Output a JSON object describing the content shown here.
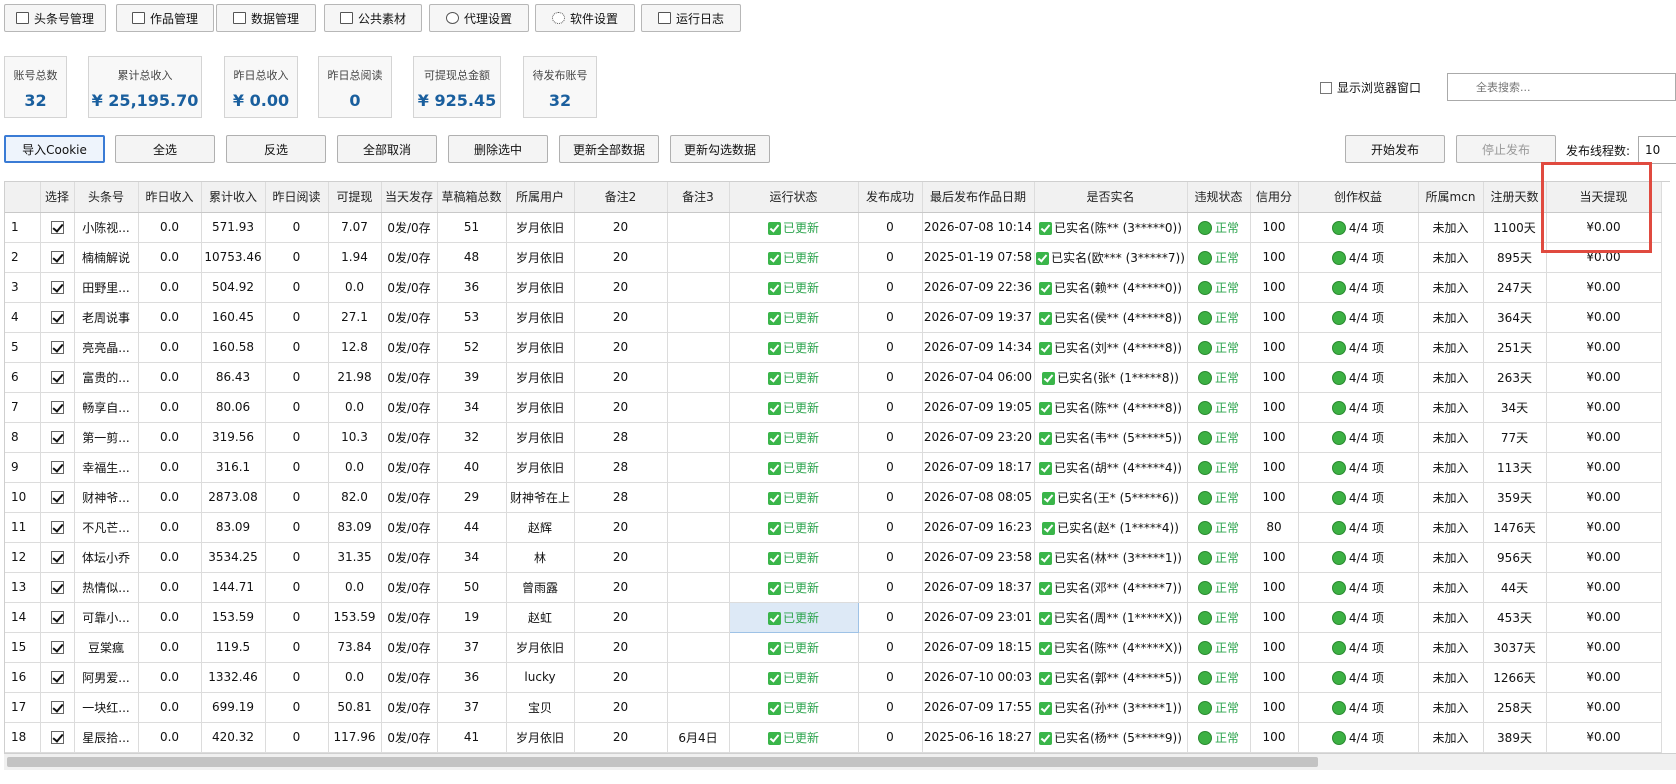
{
  "tabs": [
    {
      "label": "头条号管理",
      "icon": "list-icon"
    },
    {
      "label": "作品管理",
      "icon": "document-icon"
    },
    {
      "label": "数据管理",
      "icon": "database-icon"
    },
    {
      "label": "公共素材",
      "icon": "image-icon"
    },
    {
      "label": "代理设置",
      "icon": "globe-icon"
    },
    {
      "label": "软件设置",
      "icon": "gear-icon"
    },
    {
      "label": "运行日志",
      "icon": "log-icon"
    }
  ],
  "stats": [
    {
      "label": "账号总数",
      "value": "32"
    },
    {
      "label": "累计总收入",
      "value": "¥ 25,195.70"
    },
    {
      "label": "昨日总收入",
      "value": "¥ 0.00"
    },
    {
      "label": "昨日总阅读",
      "value": "0"
    },
    {
      "label": "可提现总金额",
      "value": "¥ 925.45"
    },
    {
      "label": "待发布账号",
      "value": "32"
    }
  ],
  "show_browser_label": "显示浏览器窗口",
  "search_placeholder": "全表搜索...",
  "actions": {
    "import_cookie": "导入Cookie",
    "select_all": "全选",
    "invert": "反选",
    "cancel_all": "全部取消",
    "delete_selected": "删除选中",
    "update_all": "更新全部数据",
    "update_checked": "更新勾选数据",
    "start_publish": "开始发布",
    "stop_publish": "停止发布",
    "thread_label": "发布线程数:",
    "thread_value": "10"
  },
  "columns": [
    "",
    "选择",
    "头条号",
    "昨日收入",
    "累计收入",
    "昨日阅读",
    "可提现",
    "当天发存",
    "草稿箱总数",
    "所属用户",
    "备注2",
    "备注3",
    "运行状态",
    "发布成功",
    "最后发布作品日期",
    "是否实名",
    "违规状态",
    "信用分",
    "创作权益",
    "所属mcn",
    "注册天数",
    "当天提现"
  ],
  "rows": [
    {
      "idx": "1",
      "name": "小陈视...",
      "yinc": "0.0",
      "total": "571.93",
      "yread": "0",
      "withdraw": "7.07",
      "today": "0发/0存",
      "drafts": "51",
      "user": "岁月依旧",
      "note2": "20",
      "note3": "",
      "status": "已更新",
      "ok": "0",
      "date": "2026-07-08 10:14",
      "real": "已实名(陈** (3*****0))",
      "viol": "正常",
      "credit": "100",
      "rights": "4/4 项",
      "mcn": "未加入",
      "days": "1100天",
      "tw": "¥0.00"
    },
    {
      "idx": "2",
      "name": "楠楠解说",
      "yinc": "0.0",
      "total": "10753.46",
      "yread": "0",
      "withdraw": "1.94",
      "today": "0发/0存",
      "drafts": "48",
      "user": "岁月依旧",
      "note2": "20",
      "note3": "",
      "status": "已更新",
      "ok": "0",
      "date": "2025-01-19 07:58",
      "real": "已实名(欧*** (3*****7))",
      "viol": "正常",
      "credit": "100",
      "rights": "4/4 项",
      "mcn": "未加入",
      "days": "895天",
      "tw": "¥0.00"
    },
    {
      "idx": "3",
      "name": "田野里...",
      "yinc": "0.0",
      "total": "504.92",
      "yread": "0",
      "withdraw": "0.0",
      "today": "0发/0存",
      "drafts": "36",
      "user": "岁月依旧",
      "note2": "20",
      "note3": "",
      "status": "已更新",
      "ok": "0",
      "date": "2026-07-09 22:36",
      "real": "已实名(赖** (4*****0))",
      "viol": "正常",
      "credit": "100",
      "rights": "4/4 项",
      "mcn": "未加入",
      "days": "247天",
      "tw": "¥0.00"
    },
    {
      "idx": "4",
      "name": "老周说事",
      "yinc": "0.0",
      "total": "160.45",
      "yread": "0",
      "withdraw": "27.1",
      "today": "0发/0存",
      "drafts": "53",
      "user": "岁月依旧",
      "note2": "20",
      "note3": "",
      "status": "已更新",
      "ok": "0",
      "date": "2026-07-09 19:37",
      "real": "已实名(侯** (4*****8))",
      "viol": "正常",
      "credit": "100",
      "rights": "4/4 项",
      "mcn": "未加入",
      "days": "364天",
      "tw": "¥0.00"
    },
    {
      "idx": "5",
      "name": "亮亮晶...",
      "yinc": "0.0",
      "total": "160.58",
      "yread": "0",
      "withdraw": "12.8",
      "today": "0发/0存",
      "drafts": "52",
      "user": "岁月依旧",
      "note2": "20",
      "note3": "",
      "status": "已更新",
      "ok": "0",
      "date": "2026-07-09 14:34",
      "real": "已实名(刘** (4*****8))",
      "viol": "正常",
      "credit": "100",
      "rights": "4/4 项",
      "mcn": "未加入",
      "days": "251天",
      "tw": "¥0.00"
    },
    {
      "idx": "6",
      "name": "富贵的...",
      "yinc": "0.0",
      "total": "86.43",
      "yread": "0",
      "withdraw": "21.98",
      "today": "0发/0存",
      "drafts": "39",
      "user": "岁月依旧",
      "note2": "20",
      "note3": "",
      "status": "已更新",
      "ok": "0",
      "date": "2026-07-04 06:00",
      "real": "已实名(张* (1*****8))",
      "viol": "正常",
      "credit": "100",
      "rights": "4/4 项",
      "mcn": "未加入",
      "days": "263天",
      "tw": "¥0.00"
    },
    {
      "idx": "7",
      "name": "畅享自...",
      "yinc": "0.0",
      "total": "80.06",
      "yread": "0",
      "withdraw": "0.0",
      "today": "0发/0存",
      "drafts": "34",
      "user": "岁月依旧",
      "note2": "20",
      "note3": "",
      "status": "已更新",
      "ok": "0",
      "date": "2026-07-09 19:05",
      "real": "已实名(陈** (4*****8))",
      "viol": "正常",
      "credit": "100",
      "rights": "4/4 项",
      "mcn": "未加入",
      "days": "34天",
      "tw": "¥0.00"
    },
    {
      "idx": "8",
      "name": "第一剪...",
      "yinc": "0.0",
      "total": "319.56",
      "yread": "0",
      "withdraw": "10.3",
      "today": "0发/0存",
      "drafts": "32",
      "user": "岁月依旧",
      "note2": "28",
      "note3": "",
      "status": "已更新",
      "ok": "0",
      "date": "2026-07-09 23:20",
      "real": "已实名(韦** (5*****5))",
      "viol": "正常",
      "credit": "100",
      "rights": "4/4 项",
      "mcn": "未加入",
      "days": "77天",
      "tw": "¥0.00"
    },
    {
      "idx": "9",
      "name": "幸福生...",
      "yinc": "0.0",
      "total": "316.1",
      "yread": "0",
      "withdraw": "0.0",
      "today": "0发/0存",
      "drafts": "40",
      "user": "岁月依旧",
      "note2": "28",
      "note3": "",
      "status": "已更新",
      "ok": "0",
      "date": "2026-07-09 18:17",
      "real": "已实名(胡** (4*****4))",
      "viol": "正常",
      "credit": "100",
      "rights": "4/4 项",
      "mcn": "未加入",
      "days": "113天",
      "tw": "¥0.00"
    },
    {
      "idx": "10",
      "name": "财神爷...",
      "yinc": "0.0",
      "total": "2873.08",
      "yread": "0",
      "withdraw": "82.0",
      "today": "0发/0存",
      "drafts": "29",
      "user": "财神爷在上",
      "note2": "28",
      "note3": "",
      "status": "已更新",
      "ok": "0",
      "date": "2026-07-08 08:05",
      "real": "已实名(王* (5*****6))",
      "viol": "正常",
      "credit": "100",
      "rights": "4/4 项",
      "mcn": "未加入",
      "days": "359天",
      "tw": "¥0.00"
    },
    {
      "idx": "11",
      "name": "不凡芒...",
      "yinc": "0.0",
      "total": "83.09",
      "yread": "0",
      "withdraw": "83.09",
      "today": "0发/0存",
      "drafts": "44",
      "user": "赵辉",
      "note2": "20",
      "note3": "",
      "status": "已更新",
      "ok": "0",
      "date": "2026-07-09 16:23",
      "real": "已实名(赵* (1*****4))",
      "viol": "正常",
      "credit": "80",
      "rights": "4/4 项",
      "mcn": "未加入",
      "days": "1476天",
      "tw": "¥0.00"
    },
    {
      "idx": "12",
      "name": "体坛小乔",
      "yinc": "0.0",
      "total": "3534.25",
      "yread": "0",
      "withdraw": "31.35",
      "today": "0发/0存",
      "drafts": "34",
      "user": "林",
      "note2": "20",
      "note3": "",
      "status": "已更新",
      "ok": "0",
      "date": "2026-07-09 23:58",
      "real": "已实名(林** (3*****1))",
      "viol": "正常",
      "credit": "100",
      "rights": "4/4 项",
      "mcn": "未加入",
      "days": "956天",
      "tw": "¥0.00"
    },
    {
      "idx": "13",
      "name": "热情似...",
      "yinc": "0.0",
      "total": "144.71",
      "yread": "0",
      "withdraw": "0.0",
      "today": "0发/0存",
      "drafts": "50",
      "user": "曾雨露",
      "note2": "20",
      "note3": "",
      "status": "已更新",
      "ok": "0",
      "date": "2026-07-09 18:37",
      "real": "已实名(邓** (4*****7))",
      "viol": "正常",
      "credit": "100",
      "rights": "4/4 项",
      "mcn": "未加入",
      "days": "44天",
      "tw": "¥0.00"
    },
    {
      "idx": "14",
      "name": "可靠小...",
      "yinc": "0.0",
      "total": "153.59",
      "yread": "0",
      "withdraw": "153.59",
      "today": "0发/0存",
      "drafts": "19",
      "user": "赵虹",
      "note2": "20",
      "note3": "",
      "status": "已更新",
      "ok": "0",
      "date": "2026-07-09 23:01",
      "real": "已实名(周** (1*****X))",
      "viol": "正常",
      "credit": "100",
      "rights": "4/4 项",
      "mcn": "未加入",
      "days": "453天",
      "tw": "¥0.00",
      "sel": true
    },
    {
      "idx": "15",
      "name": "豆棠瘋",
      "yinc": "0.0",
      "total": "119.5",
      "yread": "0",
      "withdraw": "73.84",
      "today": "0发/0存",
      "drafts": "37",
      "user": "岁月依旧",
      "note2": "20",
      "note3": "",
      "status": "已更新",
      "ok": "0",
      "date": "2026-07-09 18:15",
      "real": "已实名(陈** (4*****X))",
      "viol": "正常",
      "credit": "100",
      "rights": "4/4 项",
      "mcn": "未加入",
      "days": "3037天",
      "tw": "¥0.00"
    },
    {
      "idx": "16",
      "name": "阿男爱...",
      "yinc": "0.0",
      "total": "1332.46",
      "yread": "0",
      "withdraw": "0.0",
      "today": "0发/0存",
      "drafts": "36",
      "user": "lucky",
      "note2": "20",
      "note3": "",
      "status": "已更新",
      "ok": "0",
      "date": "2026-07-10 00:03",
      "real": "已实名(郭** (4*****5))",
      "viol": "正常",
      "credit": "100",
      "rights": "4/4 项",
      "mcn": "未加入",
      "days": "1266天",
      "tw": "¥0.00"
    },
    {
      "idx": "17",
      "name": "一块红...",
      "yinc": "0.0",
      "total": "699.19",
      "yread": "0",
      "withdraw": "50.81",
      "today": "0发/0存",
      "drafts": "37",
      "user": "宝贝",
      "note2": "20",
      "note3": "",
      "status": "已更新",
      "ok": "0",
      "date": "2026-07-09 17:55",
      "real": "已实名(孙** (3*****1))",
      "viol": "正常",
      "credit": "100",
      "rights": "4/4 项",
      "mcn": "未加入",
      "days": "258天",
      "tw": "¥0.00"
    },
    {
      "idx": "18",
      "name": "星辰拾...",
      "yinc": "0.0",
      "total": "420.32",
      "yread": "0",
      "withdraw": "117.96",
      "today": "0发/0存",
      "drafts": "41",
      "user": "岁月依旧",
      "note2": "20",
      "note3": "6月4日",
      "status": "已更新",
      "ok": "0",
      "date": "2025-06-16 18:27",
      "real": "已实名(杨** (5*****9))",
      "viol": "正常",
      "credit": "100",
      "rights": "4/4 项",
      "mcn": "未加入",
      "days": "389天",
      "tw": "¥0.00"
    }
  ],
  "colors": {
    "accent": "#1a5f9e",
    "ok_green": "#3ab54a",
    "highlight": "#e04a3f"
  }
}
